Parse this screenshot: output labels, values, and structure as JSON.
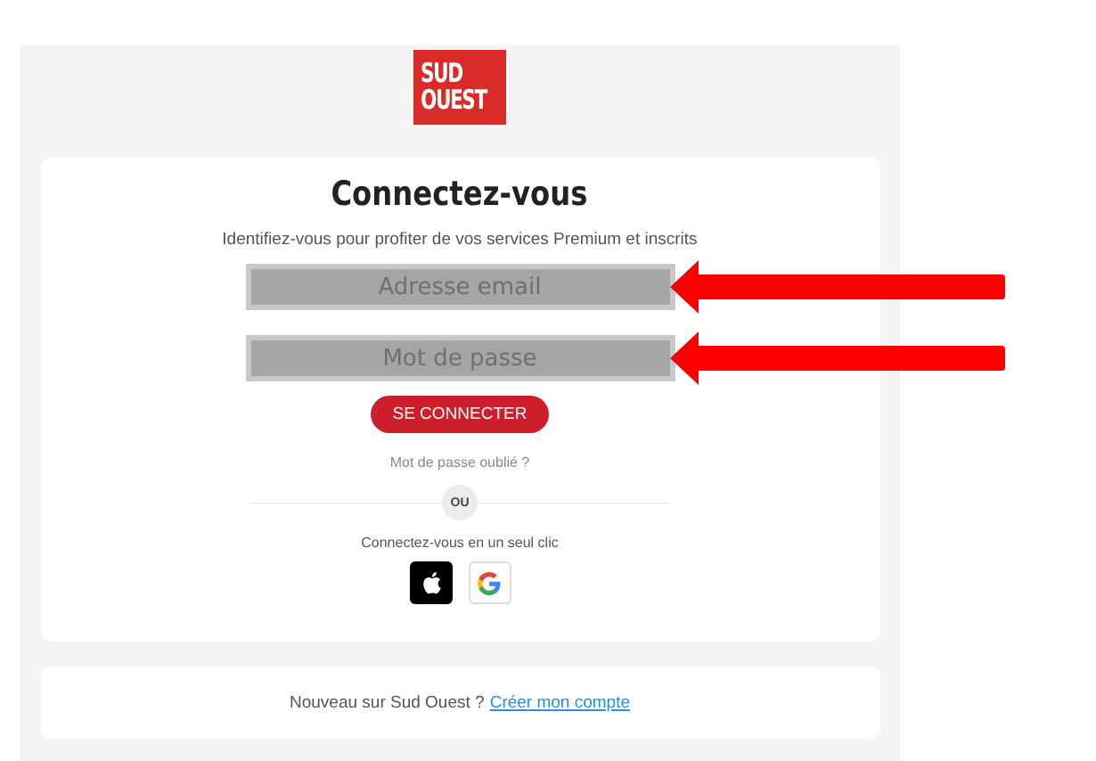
{
  "logo": {
    "lines": [
      "SUD",
      "OUEST"
    ]
  },
  "login": {
    "title": "Connectez-vous",
    "subtitle": "Identifiez-vous pour profiter de vos services Premium et inscrits",
    "fields": [
      {
        "placeholder": "Adresse email",
        "highlighted": true
      },
      {
        "placeholder": "Mot de passe",
        "highlighted": true
      }
    ],
    "submit": "SE CONNECTER",
    "forgot": "Mot de passe oublié ?",
    "separator": "OU",
    "social_label": "Connectez-vous en un seul clic",
    "social": [
      {
        "kind": "apple"
      },
      {
        "kind": "google"
      }
    ]
  },
  "signup": {
    "text": "Nouveau sur Sud Ouest ?",
    "link": "Créer mon compte"
  }
}
